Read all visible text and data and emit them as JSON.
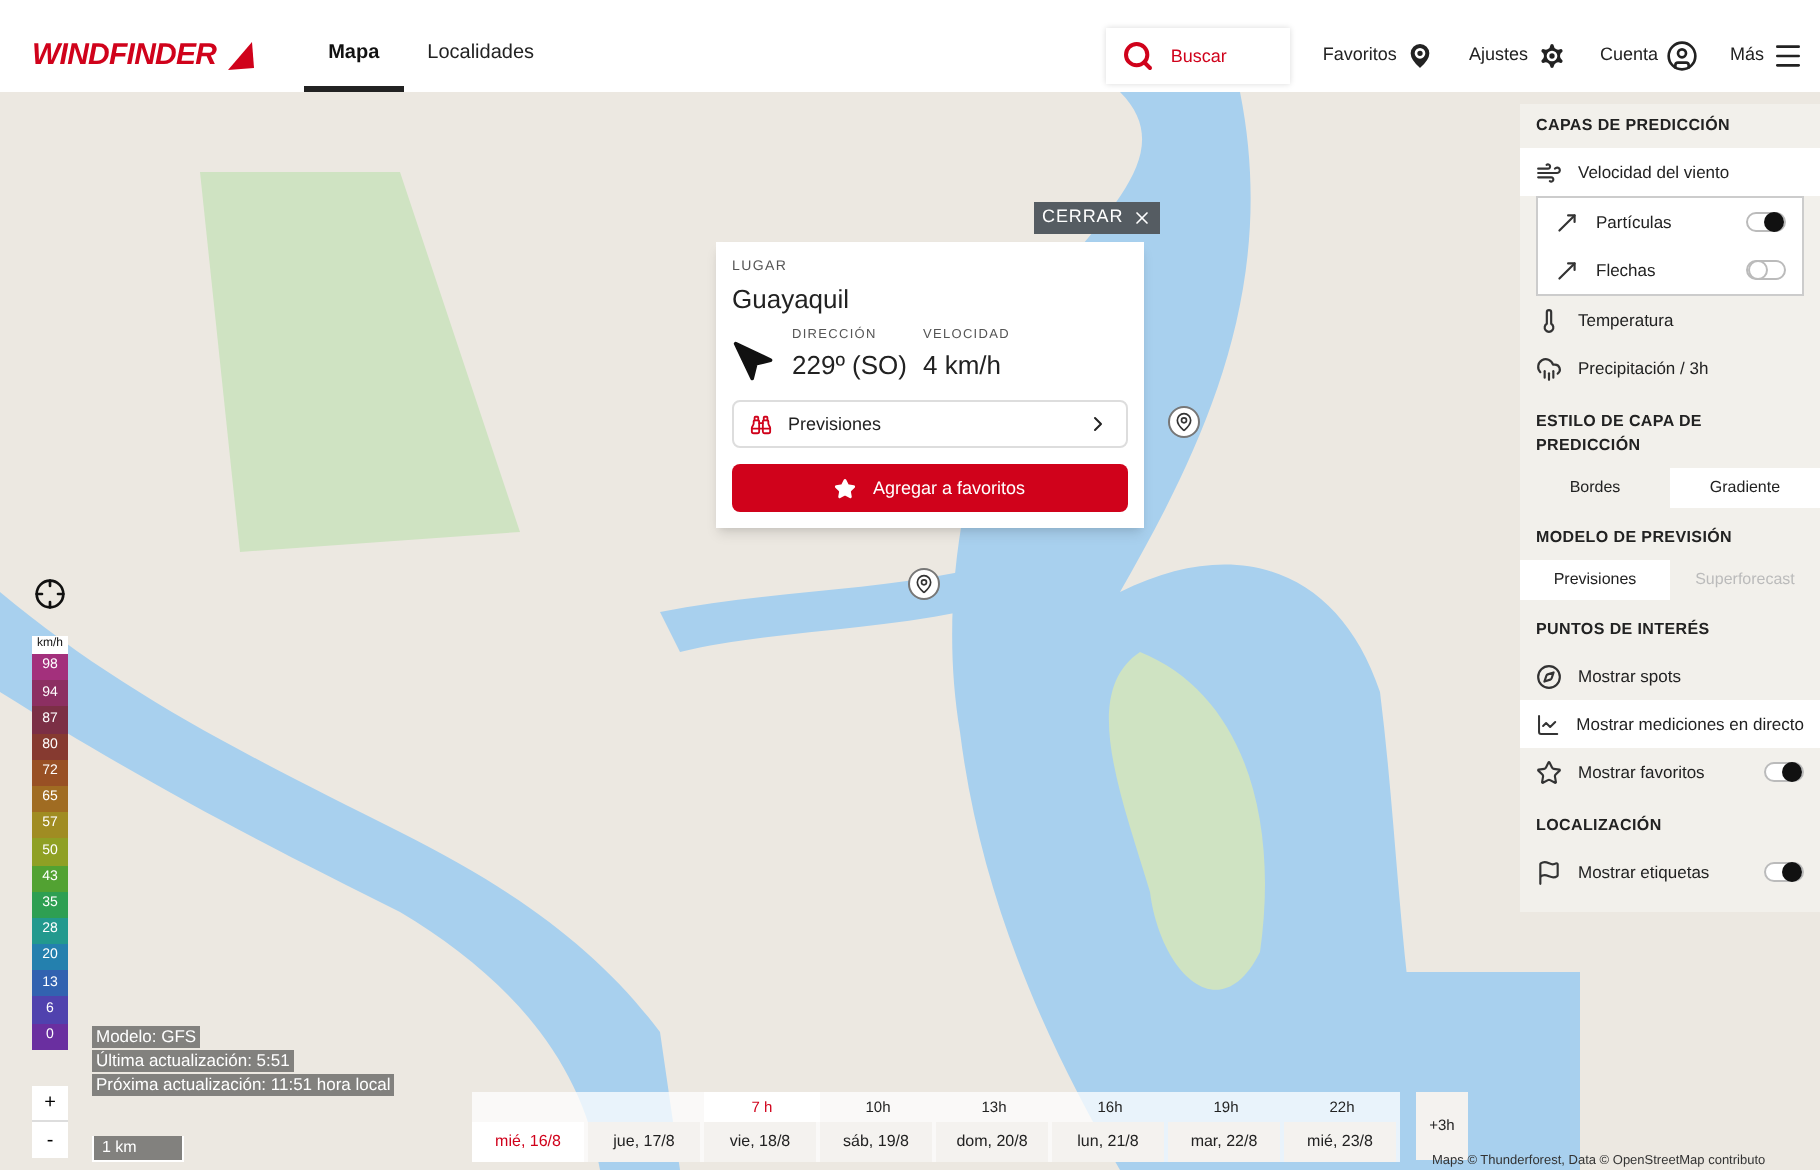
{
  "header": {
    "logo": "WINDFINDER",
    "tabs": [
      {
        "label": "Mapa",
        "selected": true
      },
      {
        "label": "Localidades",
        "selected": false
      }
    ],
    "search": {
      "placeholder": "Buscar"
    },
    "actions": [
      {
        "label": "Favoritos",
        "kind": "pin"
      },
      {
        "label": "Ajustes",
        "kind": "gear"
      },
      {
        "label": "Cuenta",
        "kind": "account"
      },
      {
        "label": "Más",
        "kind": "menu"
      }
    ]
  },
  "popup": {
    "close": "CERRAR",
    "place_label": "LUGAR",
    "place": "Guayaquil",
    "direction_label": "DIRECCIÓN",
    "direction": "229º (SO)",
    "speed_label": "VELOCIDAD",
    "speed": "4 km/h",
    "forecast_button": "Previsiones",
    "favorite_button": "Agregar a favoritos"
  },
  "legend": {
    "unit": "km/h",
    "steps": [
      {
        "value": "98",
        "color": "#a3307c"
      },
      {
        "value": "94",
        "color": "#8c2f62"
      },
      {
        "value": "87",
        "color": "#7b2f45"
      },
      {
        "value": "80",
        "color": "#863a30"
      },
      {
        "value": "72",
        "color": "#985024"
      },
      {
        "value": "65",
        "color": "#a06c22"
      },
      {
        "value": "57",
        "color": "#a08c22"
      },
      {
        "value": "50",
        "color": "#8fa024"
      },
      {
        "value": "43",
        "color": "#52a232"
      },
      {
        "value": "35",
        "color": "#2e9f52"
      },
      {
        "value": "28",
        "color": "#22998e"
      },
      {
        "value": "20",
        "color": "#2480ae"
      },
      {
        "value": "13",
        "color": "#3262b0"
      },
      {
        "value": "6",
        "color": "#5042ae"
      },
      {
        "value": "0",
        "color": "#6a2fa0"
      }
    ]
  },
  "model_info": [
    "Modelo: GFS",
    "Última actualización: 5:51",
    "Próxima actualización: 11:51 hora local"
  ],
  "zoom": {
    "in": "+",
    "out": "-"
  },
  "scale": "1 km",
  "timeline": {
    "hours": [
      "7 h",
      "10h",
      "13h",
      "16h",
      "19h",
      "22h"
    ],
    "days": [
      {
        "label": "mié, 16/8",
        "selected": true
      },
      {
        "label": "jue, 17/8",
        "selected": false
      },
      {
        "label": "vie, 18/8",
        "selected": false
      },
      {
        "label": "sáb, 19/8",
        "selected": false
      },
      {
        "label": "dom, 20/8",
        "selected": false
      },
      {
        "label": "lun, 21/8",
        "selected": false
      },
      {
        "label": "mar, 22/8",
        "selected": false
      },
      {
        "label": "mié, 23/8",
        "selected": false
      }
    ],
    "step": "+3h"
  },
  "attribution": "Maps © Thunderforest, Data © OpenStreetMap contributo",
  "panel": {
    "sections": [
      {
        "title": "CAPAS DE PREDICCIÓN",
        "items": [
          {
            "kind": "layer",
            "label": "Velocidad del viento",
            "selected": true,
            "children": [
              {
                "kind": "toggle",
                "label": "Partículas",
                "on": true
              },
              {
                "kind": "toggle",
                "label": "Flechas",
                "on": false
              }
            ]
          },
          {
            "kind": "layer",
            "label": "Temperatura",
            "selected": false
          },
          {
            "kind": "layer",
            "label": "Precipitación / 3h",
            "selected": false
          }
        ]
      },
      {
        "title": "ESTILO DE CAPA DE PREDICCIÓN",
        "segments": [
          {
            "label": "Bordes",
            "selected": false,
            "disabled": false
          },
          {
            "label": "Gradiente",
            "selected": true,
            "disabled": false
          }
        ]
      },
      {
        "title": "MODELO DE PREVISIÓN",
        "segments": [
          {
            "label": "Previsiones",
            "selected": true,
            "disabled": false
          },
          {
            "label": "Superforecast",
            "selected": false,
            "disabled": true
          }
        ]
      },
      {
        "title": "PUNTOS DE INTERÉS",
        "items": [
          {
            "kind": "layer",
            "label": "Mostrar spots",
            "selected": false
          },
          {
            "kind": "layer",
            "label": "Mostrar mediciones en directo",
            "selected": true
          },
          {
            "kind": "toggle",
            "label": "Mostrar favoritos",
            "on": true
          }
        ]
      },
      {
        "title": "LOCALIZACIÓN",
        "items": [
          {
            "kind": "toggle",
            "label": "Mostrar etiquetas",
            "on": true
          }
        ]
      }
    ]
  }
}
